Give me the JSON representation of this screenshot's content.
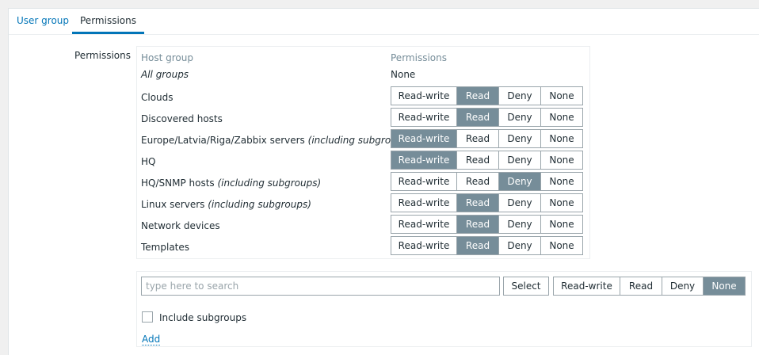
{
  "tabs": [
    {
      "label": "User group",
      "active": false
    },
    {
      "label": "Permissions",
      "active": true
    }
  ],
  "form": {
    "field_label": "Permissions"
  },
  "table": {
    "headers": {
      "host_group": "Host group",
      "permissions": "Permissions"
    },
    "all_groups": {
      "name": "All groups",
      "value": "None"
    },
    "permission_options": [
      "Read-write",
      "Read",
      "Deny",
      "None"
    ],
    "rows": [
      {
        "name": "Clouds",
        "suffix": "",
        "selected": "Read"
      },
      {
        "name": "Discovered hosts",
        "suffix": "",
        "selected": "Read"
      },
      {
        "name": "Europe/Latvia/Riga/Zabbix servers",
        "suffix": "(including subgroups)",
        "selected": "Read-write"
      },
      {
        "name": "HQ",
        "suffix": "",
        "selected": "Read-write"
      },
      {
        "name": "HQ/SNMP hosts",
        "suffix": "(including subgroups)",
        "selected": "Deny"
      },
      {
        "name": "Linux servers",
        "suffix": "(including subgroups)",
        "selected": "Read"
      },
      {
        "name": "Network devices",
        "suffix": "",
        "selected": "Read"
      },
      {
        "name": "Templates",
        "suffix": "",
        "selected": "Read"
      }
    ]
  },
  "add_form": {
    "search_placeholder": "type here to search",
    "select_label": "Select",
    "selected_permission": "None",
    "include_subgroups_label": "Include subgroups",
    "include_subgroups_checked": false,
    "add_label": "Add"
  },
  "colors": {
    "accent": "#0275b8",
    "active_segment": "#768d99",
    "header_text": "#768d99"
  }
}
